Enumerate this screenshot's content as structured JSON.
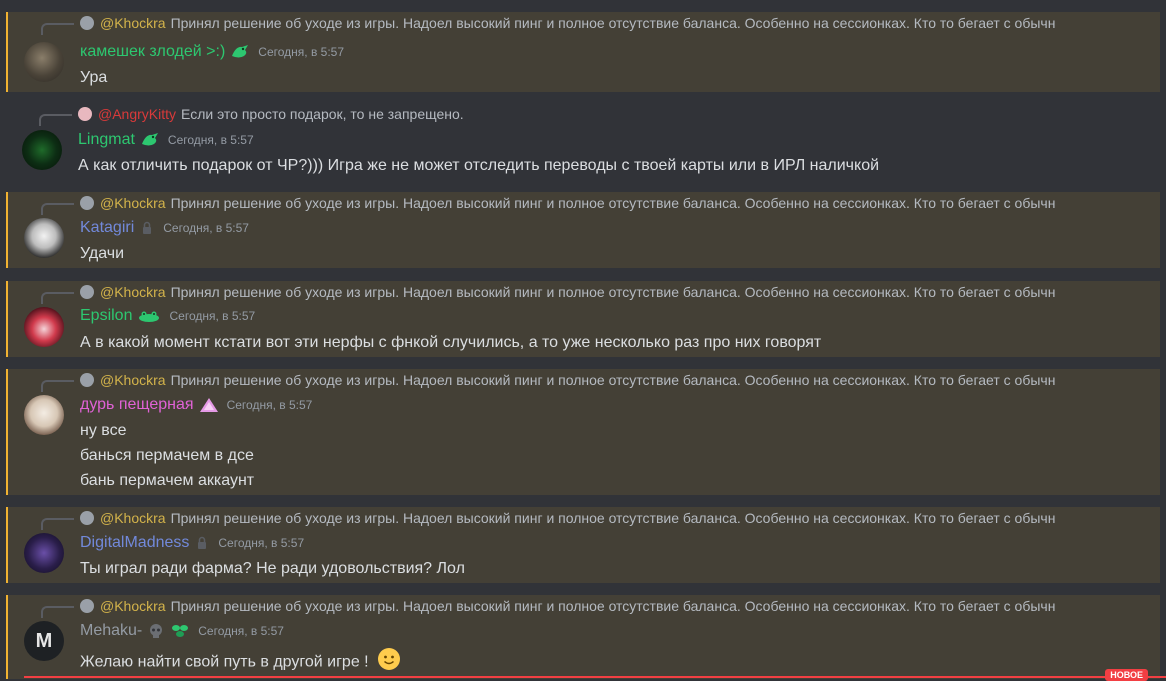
{
  "reply_snippet": "Принял решение об уходе из игры. Надоел высокий пинг и полное отсутствие баланса. Особенно на сессионках. Кто то бегает с обычн",
  "messages": [
    {
      "reply_user": "@Khockra",
      "reply_text": "Принял решение об уходе из игры. Надоел высокий пинг и полное отсутствие баланса. Особенно на сессионках. Кто то бегает с обычн",
      "username": "камешек злодей >:)",
      "username_color": "#2dc770",
      "timestamp": "Сегодня, в 5:57",
      "lines": [
        "Ура"
      ]
    },
    {
      "reply_user": "@AngryKitty",
      "reply_text": "Если это просто подарок, то не запрещено.",
      "username": "Lingmat",
      "username_color": "#2dc770",
      "timestamp": "Сегодня, в 5:57",
      "lines": [
        "А как отличить подарок от ЧР?))) Игра же не может отследить переводы с твоей карты или в ИРЛ наличкой"
      ]
    },
    {
      "reply_user": "@Khockra",
      "reply_text": "Принял решение об уходе из игры. Надоел высокий пинг и полное отсутствие баланса. Особенно на сессионках. Кто то бегает с обычн",
      "username": "Katagiri",
      "username_color": "#7289da",
      "timestamp": "Сегодня, в 5:57",
      "lines": [
        "Удачи"
      ]
    },
    {
      "reply_user": "@Khockra",
      "reply_text": "Принял решение об уходе из игры. Надоел высокий пинг и полное отсутствие баланса. Особенно на сессионках. Кто то бегает с обычн",
      "username": "Epsilon",
      "username_color": "#2dc770",
      "timestamp": "Сегодня, в 5:57",
      "lines": [
        "А в какой момент кстати вот эти нерфы с фнкой случились, а то уже несколько раз про них говорят"
      ]
    },
    {
      "reply_user": "@Khockra",
      "reply_text": "Принял решение об уходе из игры. Надоел высокий пинг и полное отсутствие баланса. Особенно на сессионках. Кто то бегает с обычн",
      "username": "дурь пещерная",
      "username_color": "#e062d6",
      "timestamp": "Сегодня, в 5:57",
      "lines": [
        "ну все",
        "банься пермачем в дсе",
        "бань пермачем аккаунт"
      ]
    },
    {
      "reply_user": "@Khockra",
      "reply_text": "Принял решение об уходе из игры. Надоел высокий пинг и полное отсутствие баланса. Особенно на сессионках. Кто то бегает с обычн",
      "username": "DigitalMadness",
      "username_color": "#7289da",
      "timestamp": "Сегодня, в 5:57",
      "lines": [
        "Ты играл ради фарма? Не ради удовольствия? Лол"
      ]
    },
    {
      "reply_user": "@Khockra",
      "reply_text": "Принял решение об уходе из игры. Надоел высокий пинг и полное отсутствие баланса. Особенно на сессионках. Кто то бегает с обычн",
      "username": "Mehaku-",
      "username_color": "#949ba4",
      "timestamp": "Сегодня, в 5:57",
      "lines": [
        "Желаю найти свой путь в другой игре !"
      ]
    }
  ],
  "avatar_letter": "M",
  "new_label": "НОВОЕ",
  "icons": {
    "dragon": "dragon-icon",
    "frog": "frog-icon",
    "triangle": "triangle-icon",
    "lock": "lock-icon",
    "skull": "skull-icon",
    "leaf": "leaf-icon",
    "smile": "slightly-smiling-face-emoji"
  },
  "colors": {
    "mention_bg": "#444036",
    "mention_bar": "#f0b232",
    "new_red": "#f23f43"
  }
}
